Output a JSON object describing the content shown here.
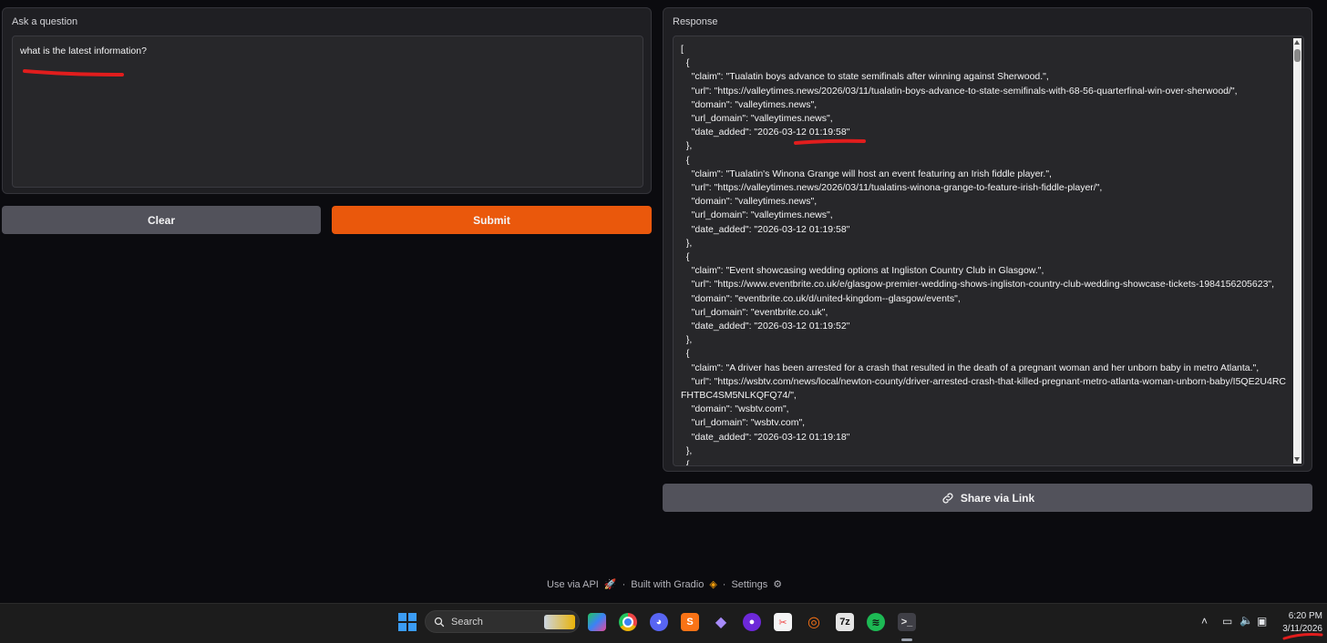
{
  "question_panel": {
    "label": "Ask a question",
    "input_value": "what is the latest information?"
  },
  "buttons": {
    "clear": "Clear",
    "submit": "Submit",
    "share": "Share via Link"
  },
  "response_panel": {
    "label": "Response",
    "text": "[\n  {\n    \"claim\": \"Tualatin boys advance to state semifinals after winning against Sherwood.\",\n    \"url\": \"https://valleytimes.news/2026/03/11/tualatin-boys-advance-to-state-semifinals-with-68-56-quarterfinal-win-over-sherwood/\",\n    \"domain\": \"valleytimes.news\",\n    \"url_domain\": \"valleytimes.news\",\n    \"date_added\": \"2026-03-12 01:19:58\"\n  },\n  {\n    \"claim\": \"Tualatin's Winona Grange will host an event featuring an Irish fiddle player.\",\n    \"url\": \"https://valleytimes.news/2026/03/11/tualatins-winona-grange-to-feature-irish-fiddle-player/\",\n    \"domain\": \"valleytimes.news\",\n    \"url_domain\": \"valleytimes.news\",\n    \"date_added\": \"2026-03-12 01:19:58\"\n  },\n  {\n    \"claim\": \"Event showcasing wedding options at Ingliston Country Club in Glasgow.\",\n    \"url\": \"https://www.eventbrite.co.uk/e/glasgow-premier-wedding-shows-ingliston-country-club-wedding-showcase-tickets-1984156205623\",\n    \"domain\": \"eventbrite.co.uk/d/united-kingdom--glasgow/events\",\n    \"url_domain\": \"eventbrite.co.uk\",\n    \"date_added\": \"2026-03-12 01:19:52\"\n  },\n  {\n    \"claim\": \"A driver has been arrested for a crash that resulted in the death of a pregnant woman and her unborn baby in metro Atlanta.\",\n    \"url\": \"https://wsbtv.com/news/local/newton-county/driver-arrested-crash-that-killed-pregnant-metro-atlanta-woman-unborn-baby/I5QE2U4RCFHTBC4SM5NLKQFQ74/\",\n    \"domain\": \"wsbtv.com\",\n    \"url_domain\": \"wsbtv.com\",\n    \"date_added\": \"2026-03-12 01:19:18\"\n  },\n  {"
  },
  "footer": {
    "use_api": "Use via API",
    "built_with": "Built with Gradio",
    "settings": "Settings",
    "separator": "·"
  },
  "taskbar": {
    "search_placeholder": "Search",
    "time": "6:20 PM",
    "date": "3/11/2026",
    "icons": [
      "windows-start-icon",
      "copilot-icon",
      "chrome-icon",
      "discord-icon",
      "sublime-icon",
      "obsidian-icon",
      "github-icon",
      "snipping-tool-icon",
      "jupyter-icon",
      "7zip-icon",
      "spotify-icon",
      "terminal-icon"
    ]
  },
  "colors": {
    "submit_bg": "#ea580c",
    "clear_bg": "#52525b",
    "panel_bg": "#1f1f23",
    "annotation_red": "#e11d1d"
  }
}
